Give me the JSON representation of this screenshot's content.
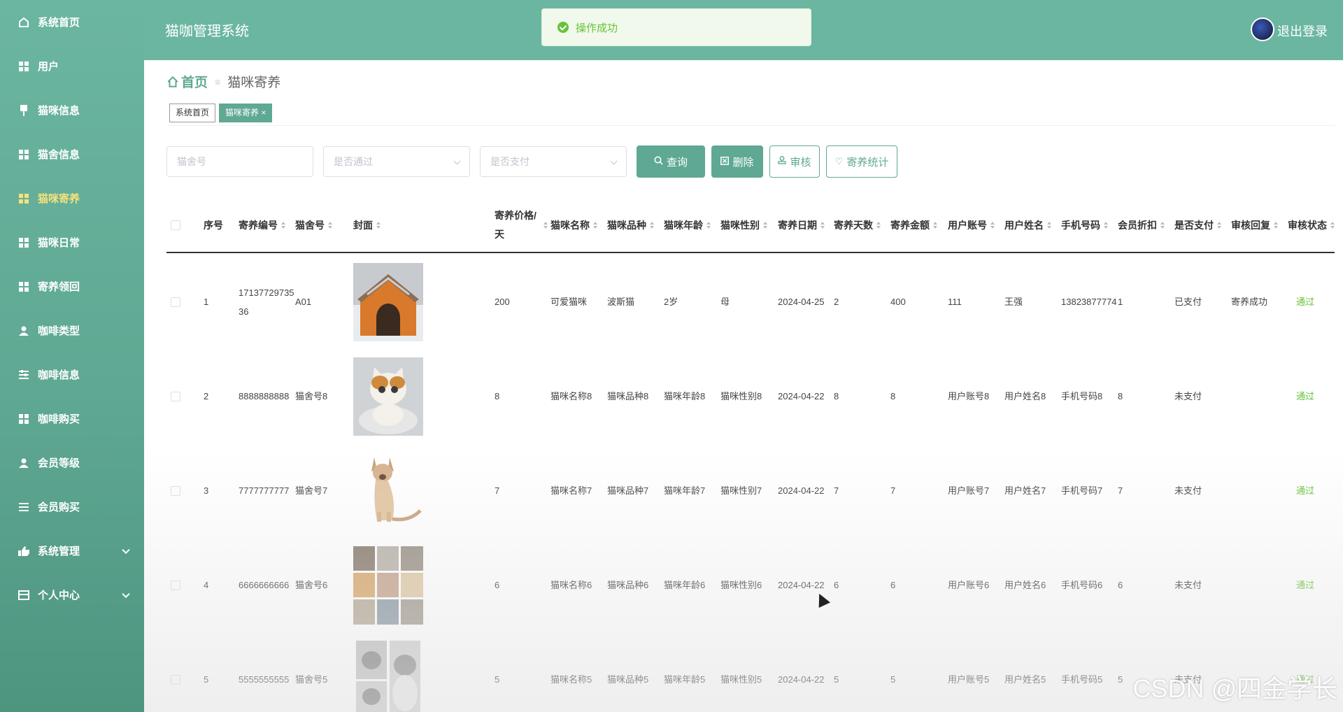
{
  "sidebar": {
    "items": [
      {
        "label": "系统首页",
        "icon": "home-icon"
      },
      {
        "label": "用户",
        "icon": "grid-icon"
      },
      {
        "label": "猫咪信息",
        "icon": "pin-icon"
      },
      {
        "label": "猫舍信息",
        "icon": "grid-icon"
      },
      {
        "label": "猫咪寄养",
        "icon": "grid-icon",
        "active": true
      },
      {
        "label": "猫咪日常",
        "icon": "grid-icon"
      },
      {
        "label": "寄养领回",
        "icon": "grid-icon"
      },
      {
        "label": "咖啡类型",
        "icon": "person-icon"
      },
      {
        "label": "咖啡信息",
        "icon": "sliders-icon"
      },
      {
        "label": "咖啡购买",
        "icon": "grid-icon"
      },
      {
        "label": "会员等级",
        "icon": "person-icon"
      },
      {
        "label": "会员购买",
        "icon": "list-icon"
      },
      {
        "label": "系统管理",
        "icon": "thumb-icon"
      },
      {
        "label": "个人中心",
        "icon": "card-icon"
      }
    ]
  },
  "header": {
    "title": "猫咖管理系统",
    "logout": "退出登录"
  },
  "toast": {
    "message": "操作成功"
  },
  "breadcrumb": {
    "home": "首页",
    "separator": "≡",
    "current": "猫咪寄养"
  },
  "tags": {
    "home": "系统首页",
    "current": "猫咪寄养"
  },
  "toolbar": {
    "cattery_placeholder": "猫舍号",
    "approved_placeholder": "是否通过",
    "paid_placeholder": "是否支付",
    "search": "查询",
    "delete": "删除",
    "review": "审核",
    "stats": "寄养统计"
  },
  "table": {
    "headers": [
      "序号",
      "寄养编号",
      "猫舍号",
      "封面",
      "寄养价格/天",
      "猫咪名称",
      "猫咪品种",
      "猫咪年龄",
      "猫咪性别",
      "寄养日期",
      "寄养天数",
      "寄养金额",
      "用户账号",
      "用户姓名",
      "手机号码",
      "会员折扣",
      "是否支付",
      "审核回复",
      "审核状态"
    ],
    "rows": [
      {
        "no": "1",
        "code": "1713772973536",
        "cattery": "A01",
        "cover": "cat-house",
        "price": "200",
        "name": "可爱猫咪",
        "breed": "波斯猫",
        "age": "2岁",
        "gender": "母",
        "date": "2024-04-25",
        "days": "2",
        "amount": "400",
        "account": "111",
        "username": "王强",
        "phone": "13823877774",
        "discount": "1",
        "paid": "已支付",
        "reply": "寄养成功",
        "status": "通过"
      },
      {
        "no": "2",
        "code": "8888888888",
        "cattery": "猫舍号8",
        "cover": "white-cat",
        "price": "8",
        "name": "猫咪名称8",
        "breed": "猫咪品种8",
        "age": "猫咪年龄8",
        "gender": "猫咪性别8",
        "date": "2024-04-22",
        "days": "8",
        "amount": "8",
        "account": "用户账号8",
        "username": "用户姓名8",
        "phone": "手机号码8",
        "discount": "8",
        "paid": "未支付",
        "reply": "",
        "status": "通过"
      },
      {
        "no": "3",
        "code": "7777777777",
        "cattery": "猫舍号7",
        "cover": "siamese-cat",
        "price": "7",
        "name": "猫咪名称7",
        "breed": "猫咪品种7",
        "age": "猫咪年龄7",
        "gender": "猫咪性别7",
        "date": "2024-04-22",
        "days": "7",
        "amount": "7",
        "account": "用户账号7",
        "username": "用户姓名7",
        "phone": "手机号码7",
        "discount": "7",
        "paid": "未支付",
        "reply": "",
        "status": "通过"
      },
      {
        "no": "4",
        "code": "6666666666",
        "cattery": "猫舍号6",
        "cover": "cat-collage",
        "price": "6",
        "name": "猫咪名称6",
        "breed": "猫咪品种6",
        "age": "猫咪年龄6",
        "gender": "猫咪性别6",
        "date": "2024-04-22",
        "days": "6",
        "amount": "6",
        "account": "用户账号6",
        "username": "用户姓名6",
        "phone": "手机号码6",
        "discount": "6",
        "paid": "未支付",
        "reply": "",
        "status": "通过"
      },
      {
        "no": "5",
        "code": "5555555555",
        "cattery": "猫舍号5",
        "cover": "gray-cats",
        "price": "5",
        "name": "猫咪名称5",
        "breed": "猫咪品种5",
        "age": "猫咪年龄5",
        "gender": "猫咪性别5",
        "date": "2024-04-22",
        "days": "5",
        "amount": "5",
        "account": "用户账号5",
        "username": "用户姓名5",
        "phone": "手机号码5",
        "discount": "5",
        "paid": "未支付",
        "reply": "",
        "status": "通过"
      }
    ]
  },
  "watermark": "CSDN @四金学长",
  "colors": {
    "primary": "#5fa893",
    "header": "#6bb6a1",
    "success": "#67c23a",
    "active_nav": "#f6e27a"
  }
}
